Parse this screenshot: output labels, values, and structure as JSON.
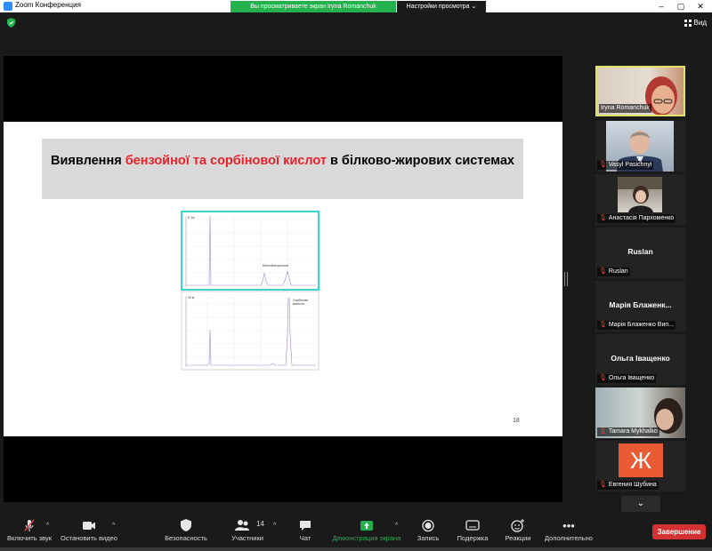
{
  "window": {
    "title": "Zoom Конференция",
    "share_banner": "Вы просматриваете экран Iryna Romanchuk",
    "view_options": "Настройки просмотра",
    "view_button": "Вид",
    "controls": {
      "minimize": "–",
      "maximize": "▢",
      "close": "✕"
    }
  },
  "slide": {
    "title_black_1": "Виявлення ",
    "title_red": "бензойної та сорбінової кислот",
    "title_black_2": " в білково-жирових системах",
    "page_number": "18",
    "chart_labels": {
      "top_tag": "Б 1м",
      "top_peak": "Бензойна кислота",
      "bottom_tag": "29 м",
      "bottom_peak": "Сорбінова кислота"
    }
  },
  "participants": [
    {
      "name": "Iryna Romanchuk",
      "muted": false,
      "active": true,
      "kind": "video"
    },
    {
      "name": "Vasyl Pasichnyi",
      "muted": true,
      "active": false,
      "kind": "video"
    },
    {
      "name": "Анастасія Пархоменко",
      "muted": true,
      "active": false,
      "kind": "video"
    },
    {
      "name": "Ruslan",
      "display": "Ruslan",
      "muted": true,
      "active": false,
      "kind": "name"
    },
    {
      "name": "Марія Блаженко Вип...",
      "display": "Марія  Блаженк...",
      "muted": true,
      "active": false,
      "kind": "name"
    },
    {
      "name": "Ольга Іващенко",
      "display": "Ольга Іващенко",
      "muted": true,
      "active": false,
      "kind": "name"
    },
    {
      "name": "Tamara Mykhalko",
      "muted": true,
      "active": false,
      "kind": "video"
    },
    {
      "name": "Евгения Шубина",
      "avatar_letter": "Ж",
      "muted": true,
      "active": false,
      "kind": "avatar"
    }
  ],
  "toolbar": {
    "unmute": "Включить звук",
    "start_video": "Остановить видео",
    "security": "Безопасность",
    "participants": "Участники",
    "participants_count": "14",
    "chat": "Чат",
    "share": "Демонстрация экрана",
    "record": "Запись",
    "subtitles": "Подержка",
    "reactions": "Реакции",
    "more": "Дополнительно",
    "end": "Завершение"
  },
  "colors": {
    "share_green": "#23b14d",
    "end_red": "#d43133",
    "active_border": "#e3e16a",
    "slide_red": "#e8212b"
  }
}
